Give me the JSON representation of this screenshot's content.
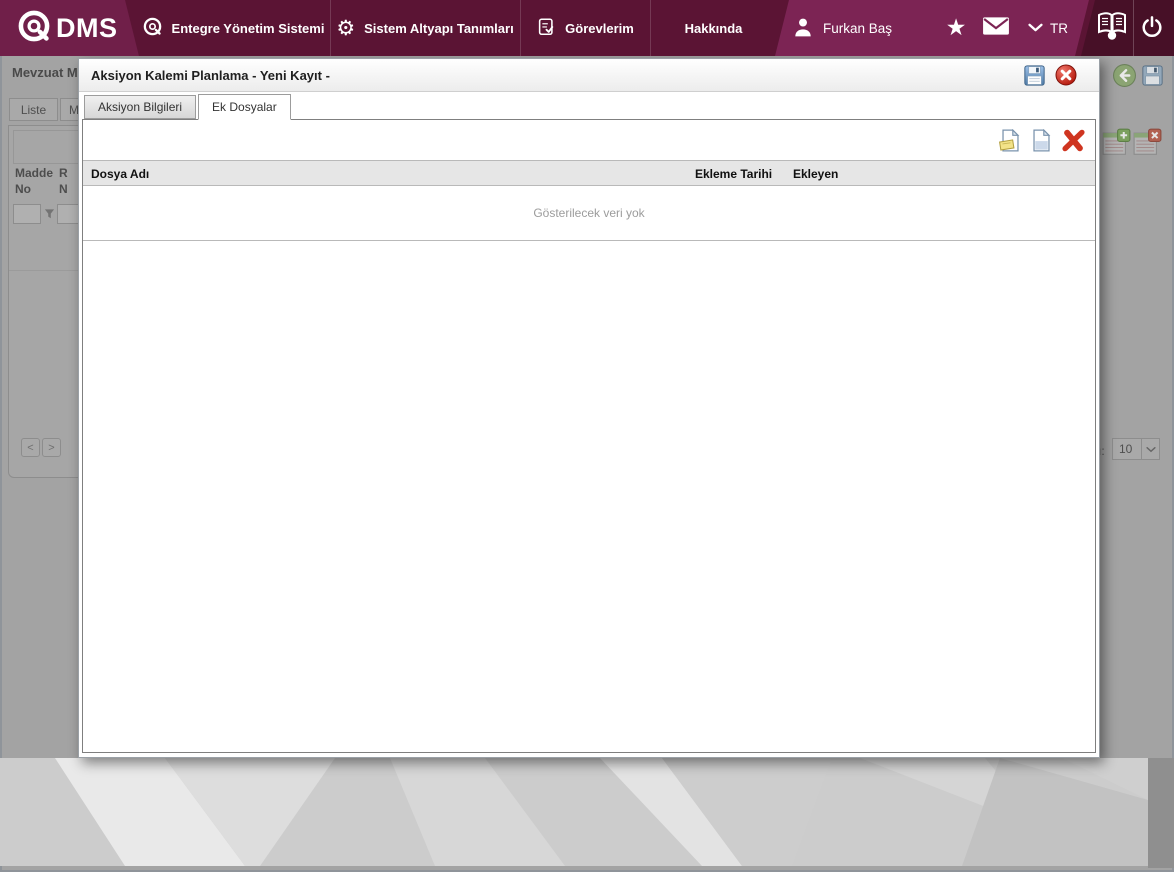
{
  "topbar": {
    "logo_text": "DMS",
    "menu": [
      {
        "label": "Entegre Yönetim Sistemi"
      },
      {
        "label": "Sistem Altyapı Tanımları"
      },
      {
        "label": "Görevlerim"
      },
      {
        "label": "Hakkında"
      }
    ],
    "user_name": "Furkan Baş",
    "language": "TR",
    "star_glyph": "★",
    "gear_glyph": "⚙"
  },
  "modal": {
    "title": "Aksiyon Kalemi Planlama - Yeni Kayıt -",
    "tab_info": "Aksiyon Bilgileri",
    "tab_files": "Ek Dosyalar",
    "grid": {
      "col_file": "Dosya Adı",
      "col_date": "Ekleme Tarihi",
      "col_user": "Ekleyen",
      "empty": "Gösterilecek veri yok"
    }
  },
  "background_page": {
    "title": "Mevzuat Ma",
    "tab_liste": "Liste",
    "tab_partial": "M",
    "col1_line1": "Madde",
    "col1_line2": "No",
    "col2_line1": "R",
    "col2_line2": "N",
    "pager_prev": "<",
    "pager_next": ">",
    "page_size_label": "ı:",
    "page_size_value": "10"
  },
  "colors": {
    "topbar_dark": "#5b1434",
    "topbar_light": "#7c2454",
    "topbar_darker": "#471027",
    "save_blue": "#4f7ca8",
    "close_red": "#b01205",
    "delete_red": "#cf3520",
    "grid_header_bg": "#e6e6e6"
  }
}
